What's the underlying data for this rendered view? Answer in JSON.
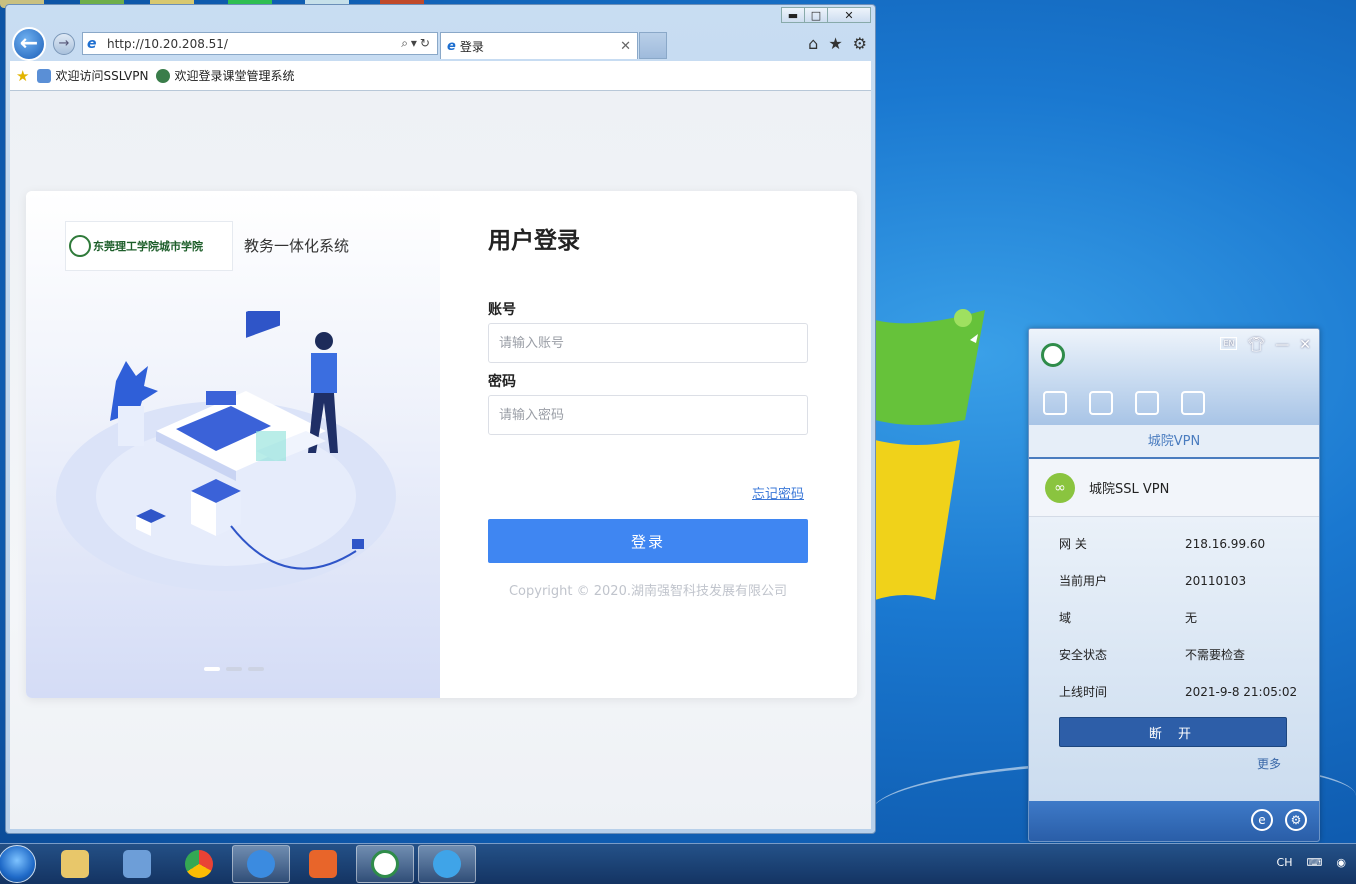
{
  "browser": {
    "address_url": "http://10.20.208.51/",
    "tab_title": "登录",
    "favorites": [
      "欢迎访问SSLVPN",
      "欢迎登录课堂管理系统"
    ],
    "window_controls": {
      "minimize": "▬",
      "maximize": "□",
      "close": "✕"
    }
  },
  "login_page": {
    "school_logo_text": "东莞理工学院城市学院",
    "system_name": "教务一体化系统",
    "title": "用户登录",
    "account_label": "账号",
    "account_placeholder": "请输入账号",
    "password_label": "密码",
    "password_placeholder": "请输入密码",
    "forgot_password": "忘记密码",
    "login_button": "登录",
    "copyright": "Copyright © 2020.湖南强智科技发展有限公司"
  },
  "vpn_client": {
    "lang_badge": "EN",
    "profile_name": "城院VPN",
    "connection_name": "城院SSL VPN",
    "info": [
      {
        "key": "网 关",
        "value": "218.16.99.60"
      },
      {
        "key": "当前用户",
        "value": "20110103"
      },
      {
        "key": "域",
        "value": "无"
      },
      {
        "key": "安全状态",
        "value": "不需要检查"
      },
      {
        "key": "上线时间",
        "value": "2021-9-8 21:05:02"
      }
    ],
    "disconnect_button": "断 开",
    "more_link": "更多",
    "colors": {
      "header": "#a8c4e6",
      "button": "#2d5ea8",
      "accent_green": "#8ac43f"
    }
  },
  "taskbar": {
    "tray_lang": "CH",
    "apps": [
      "explorer-icon",
      "computer-icon",
      "chrome-icon",
      "ie-icon",
      "app-icon",
      "school-vpn-icon",
      "qq-icon"
    ]
  },
  "colors": {
    "primary_blue": "#3f86f2",
    "link_blue": "#3b78d8"
  }
}
